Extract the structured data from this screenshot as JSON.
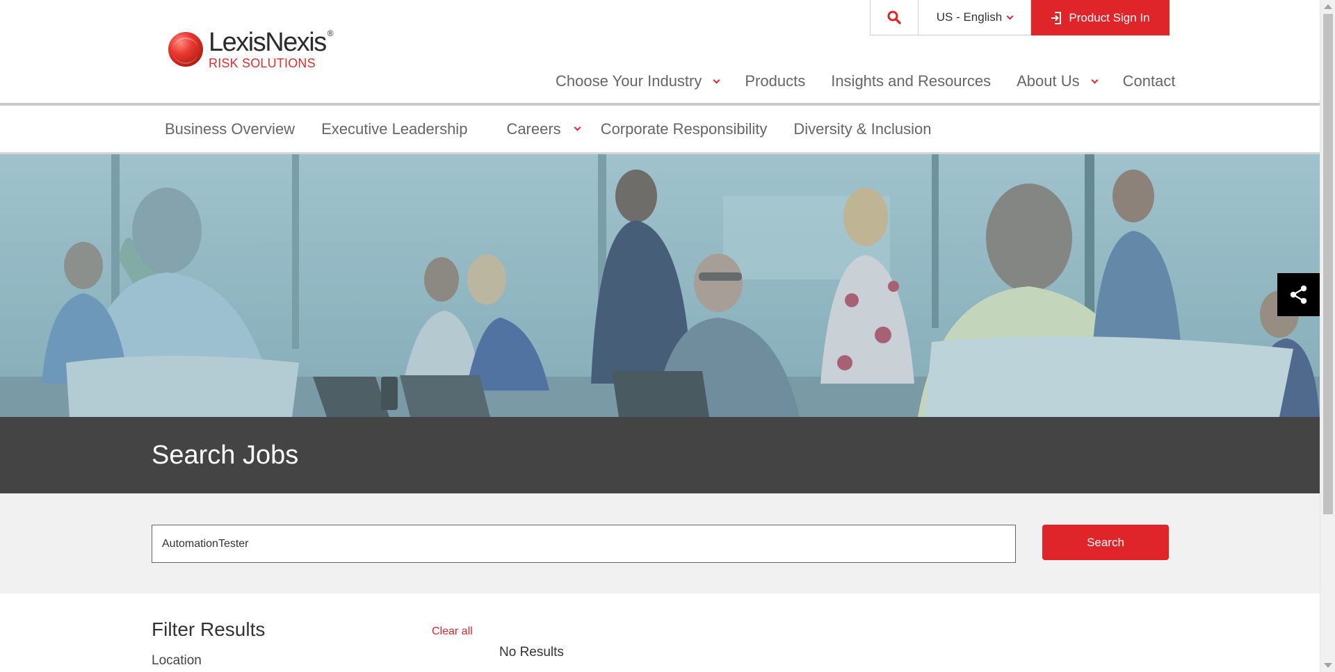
{
  "brand": {
    "name": "LexisNexis",
    "registered": "®",
    "tagline": "RISK SOLUTIONS"
  },
  "utility": {
    "language": "US - English",
    "sign_in": "Product Sign In"
  },
  "main_nav": [
    {
      "label": "Choose Your Industry",
      "dropdown": true
    },
    {
      "label": "Products",
      "dropdown": false
    },
    {
      "label": "Insights and Resources",
      "dropdown": false
    },
    {
      "label": "About Us",
      "dropdown": true
    },
    {
      "label": "Contact",
      "dropdown": false
    }
  ],
  "sub_nav": [
    {
      "label": "Business Overview",
      "dropdown": false
    },
    {
      "label": "Executive Leadership",
      "dropdown": false
    },
    {
      "label": "Careers",
      "dropdown": true
    },
    {
      "label": "Corporate Responsibility",
      "dropdown": false
    },
    {
      "label": "Diversity & Inclusion",
      "dropdown": false
    }
  ],
  "page": {
    "title": "Search Jobs"
  },
  "search": {
    "value": "AutomationTester",
    "button": "Search"
  },
  "filters": {
    "title": "Filter Results",
    "clear_all": "Clear all",
    "location_label": "Location"
  },
  "results": {
    "status": "No Results"
  },
  "colors": {
    "brand_red": "#e0252a",
    "title_band": "#444444",
    "search_band": "#f1f1f1"
  }
}
